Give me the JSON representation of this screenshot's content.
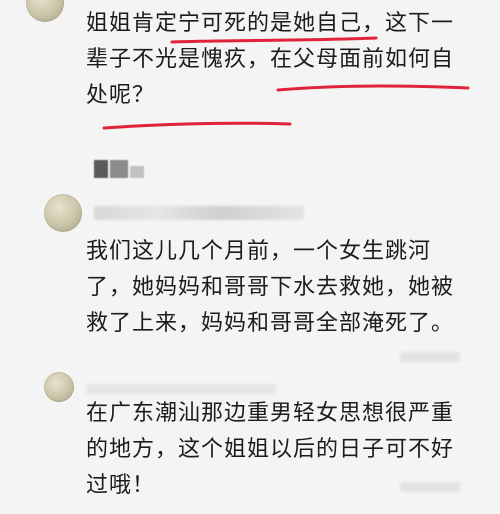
{
  "comments": [
    {
      "text": "姐姐肯定宁可死的是她自己，这下一辈子不光是愧疚，在父母面前如何自处呢？"
    },
    {
      "text": "我们这儿几个月前，一个女生跳河了，她妈妈和哥哥下水去救她，她被救了上来，妈妈和哥哥全部淹死了。"
    },
    {
      "text": "在广东潮汕那边重男轻女思想很严重的地方，这个姐姐以后的日子可不好过哦！"
    }
  ],
  "colors": {
    "background": "#f4f4f4",
    "text": "#1c1c1c",
    "underline": "#e0223a"
  }
}
